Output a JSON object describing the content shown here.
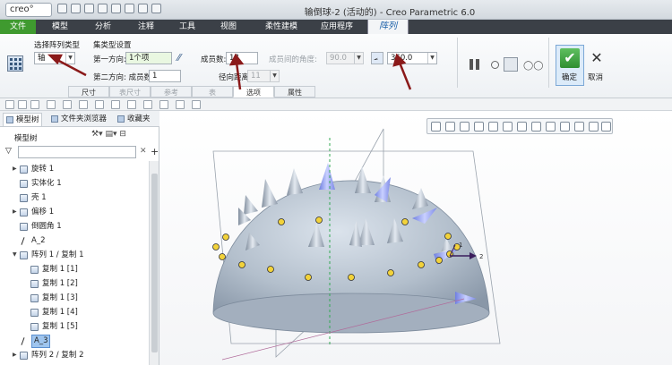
{
  "title_bar": {
    "logo": "creo°",
    "window_title": "输倒球-2 (活动的) - Creo Parametric 6.0"
  },
  "ribbon_tabs": [
    "文件",
    "模型",
    "分析",
    "注释",
    "工具",
    "视图",
    "柔性建模",
    "应用程序",
    "阵列"
  ],
  "pattern_panel": {
    "type_label": "选择阵列类型",
    "type_value": "轴",
    "set_label": "集类型设置",
    "dir1_label": "第一方向:",
    "dir1_value": "1个项",
    "dir2_label": "第二方向: 成员数:",
    "dir2_value": "1",
    "members_label": "成员数:",
    "members_value": "18",
    "angle_between_label": "成员间的角度:",
    "angle_between_value": "90.0",
    "radial_label": "径向距离:",
    "radial_value": "11",
    "total_angle_value": "360.0",
    "ok_label": "确定",
    "cancel_label": "取消"
  },
  "sub_tabs": [
    {
      "label": "尺寸",
      "enabled": true
    },
    {
      "label": "表尺寸",
      "enabled": false
    },
    {
      "label": "参考",
      "enabled": false
    },
    {
      "label": "表",
      "enabled": false
    },
    {
      "label": "选项",
      "enabled": true
    },
    {
      "label": "属性",
      "enabled": true
    }
  ],
  "panel_tabs": [
    "模型树",
    "文件夹浏览器",
    "收藏夹"
  ],
  "model_tree": {
    "header": "模型树",
    "items": [
      {
        "label": "旋转 1",
        "toggle": "▶",
        "icon": "revolve-icon"
      },
      {
        "label": "实体化 1",
        "toggle": "",
        "icon": "solidify-icon"
      },
      {
        "label": "壳 1",
        "toggle": "",
        "icon": "shell-icon"
      },
      {
        "label": "偏移 1",
        "toggle": "▶",
        "icon": "offset-icon"
      },
      {
        "label": "倒圆角 1",
        "toggle": "",
        "icon": "round-icon"
      },
      {
        "label": "A_2",
        "toggle": "",
        "icon": "axis-icon"
      },
      {
        "label": "阵列 1 / 复制 1",
        "toggle": "▼",
        "icon": "pattern-icon"
      },
      {
        "label": "复制 1 [1]",
        "toggle": "",
        "icon": "copy-icon",
        "indent": true
      },
      {
        "label": "复制 1 [2]",
        "toggle": "",
        "icon": "copy-icon",
        "indent": true
      },
      {
        "label": "复制 1 [3]",
        "toggle": "",
        "icon": "copy-icon",
        "indent": true
      },
      {
        "label": "复制 1 [4]",
        "toggle": "",
        "icon": "copy-icon",
        "indent": true
      },
      {
        "label": "复制 1 [5]",
        "toggle": "",
        "icon": "copy-icon",
        "indent": true
      },
      {
        "label": "A_3",
        "toggle": "",
        "icon": "axis-icon",
        "selected": true
      },
      {
        "label": "阵列 2 / 复制 2",
        "toggle": "▶",
        "icon": "pattern-icon"
      }
    ]
  },
  "graphics": {
    "axis_label_1": "1",
    "axis_label_2": "2"
  },
  "colors": {
    "file_tab": "#3f9a2f",
    "ok_button": "#2e8f31",
    "annotation_arrow": "#8b1a1a",
    "model_body": "#b8c3d0",
    "accent_spike": "#8ea0ee"
  }
}
